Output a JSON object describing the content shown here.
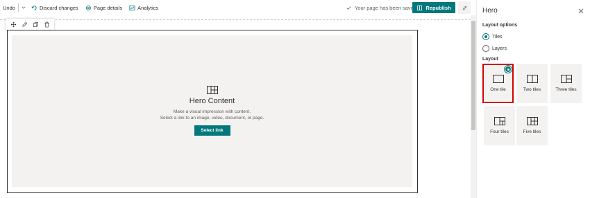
{
  "toolbar": {
    "undo_label": "Undo",
    "discard_label": "Discard changes",
    "page_details_label": "Page details",
    "analytics_label": "Analytics",
    "saved_status": "Your page has been saved",
    "republish_label": "Republish"
  },
  "hero": {
    "title": "Hero Content",
    "desc_line1": "Make a visual impression with content.",
    "desc_line2": "Select a link to an image, video, document, or page.",
    "select_link_label": "Select link"
  },
  "panel": {
    "title": "Hero",
    "layout_options_label": "Layout options",
    "options": [
      {
        "label": "Tiles",
        "selected": true
      },
      {
        "label": "Layers",
        "selected": false
      }
    ],
    "layout_label": "Layout",
    "tiles": [
      {
        "label": "One tile",
        "icon": "one-tile-icon",
        "selected": true
      },
      {
        "label": "Two tiles",
        "icon": "two-tiles-icon",
        "selected": false
      },
      {
        "label": "Three tiles",
        "icon": "three-tiles-icon",
        "selected": false
      },
      {
        "label": "Four tiles",
        "icon": "four-tiles-icon",
        "selected": false
      },
      {
        "label": "Five tiles",
        "icon": "five-tiles-icon",
        "selected": false
      }
    ]
  },
  "colors": {
    "accent": "#03787c",
    "selection_border": "#d40000",
    "canvas_bg": "#f3f2f1"
  }
}
